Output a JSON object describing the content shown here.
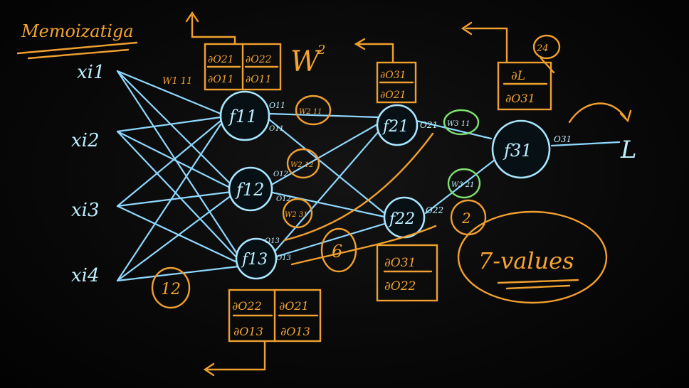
{
  "title": "Memoizatiga",
  "inputs": [
    "xi1",
    "xi2",
    "xi3",
    "xi4"
  ],
  "nodes": {
    "f11": "f11",
    "f12": "f12",
    "f13": "f13",
    "f21": "f21",
    "f22": "f22",
    "f31": "f31"
  },
  "outputs": {
    "o11": "O11",
    "o11b": "O11",
    "o12": "O12",
    "o12b": "O12",
    "o13": "O13",
    "o13b": "O13",
    "o21": "O21",
    "o22": "O22",
    "o31": "O31"
  },
  "loss": "L",
  "layer_label": "W",
  "layer_sup": "2",
  "weights": {
    "w1_11": "W1 11",
    "w2_11": "W2 11",
    "w2_12": "W2 12",
    "w2_31": "W2 31",
    "w3_11": "W3 11",
    "w3_21": "W3 21"
  },
  "derivs": {
    "top1_num": "∂O21",
    "top1_den": "∂O11",
    "top2_num": "∂O22",
    "top2_den": "∂O11",
    "mid_num": "∂O31",
    "mid_den": "∂O21",
    "right_num": "∂L",
    "right_den": "∂O31",
    "low_num": "∂O31",
    "low_den": "∂O22",
    "bot1_num": "∂O22",
    "bot1_den": "∂O13",
    "bot2_num": "∂O21",
    "bot2_den": "∂O13"
  },
  "counts": {
    "c12": "12",
    "c6": "6",
    "c2": "2",
    "c24": "24"
  },
  "note": "7-values",
  "colors": {
    "chalk_blue": "#bfefff",
    "chalk_orange": "#f3a431",
    "board": "#050505"
  }
}
